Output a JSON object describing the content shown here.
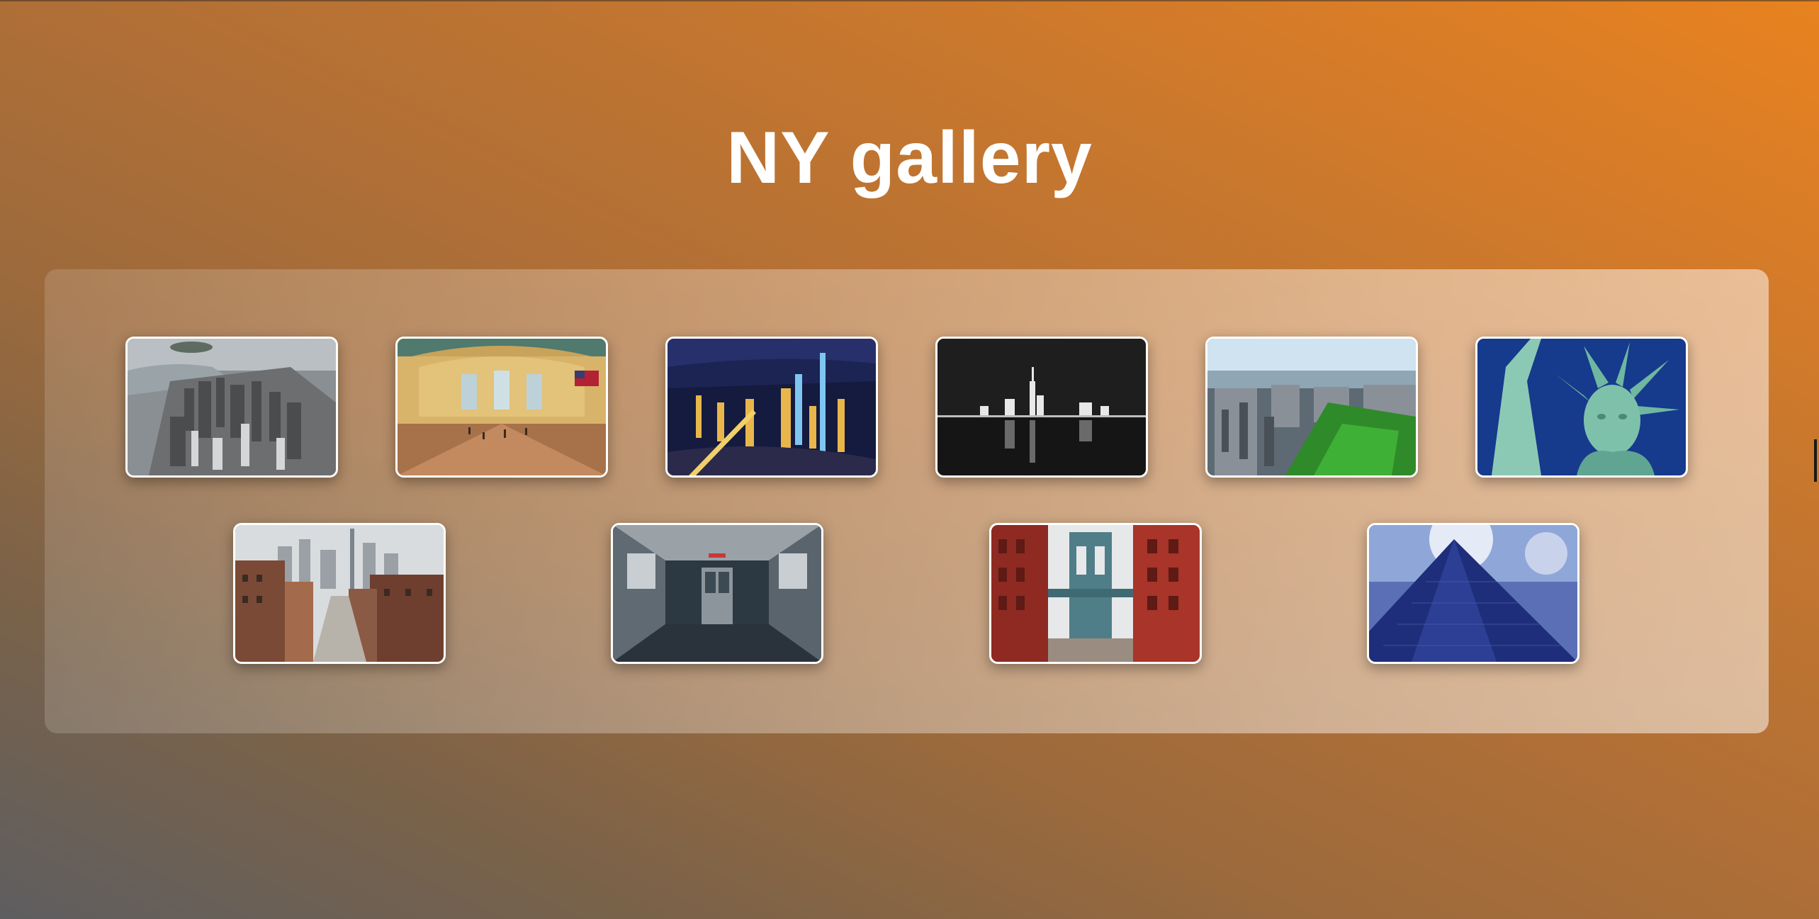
{
  "page": {
    "title": "NY gallery"
  },
  "gallery": {
    "photos": [
      {
        "icon": "aerial-manhattan-image"
      },
      {
        "icon": "grand-central-terminal-image"
      },
      {
        "icon": "night-city-aerial-image"
      },
      {
        "icon": "black-white-skyline-image"
      },
      {
        "icon": "central-park-aerial-image"
      },
      {
        "icon": "statue-of-liberty-image"
      },
      {
        "icon": "manhattan-street-image"
      },
      {
        "icon": "subway-car-interior-image"
      },
      {
        "icon": "manhattan-bridge-image"
      },
      {
        "icon": "glass-skyscraper-image"
      }
    ]
  },
  "colors": {
    "background_start": "#5e5e60",
    "background_end": "#e8821f",
    "title": "#ffffff",
    "frame": "#ffffff"
  }
}
